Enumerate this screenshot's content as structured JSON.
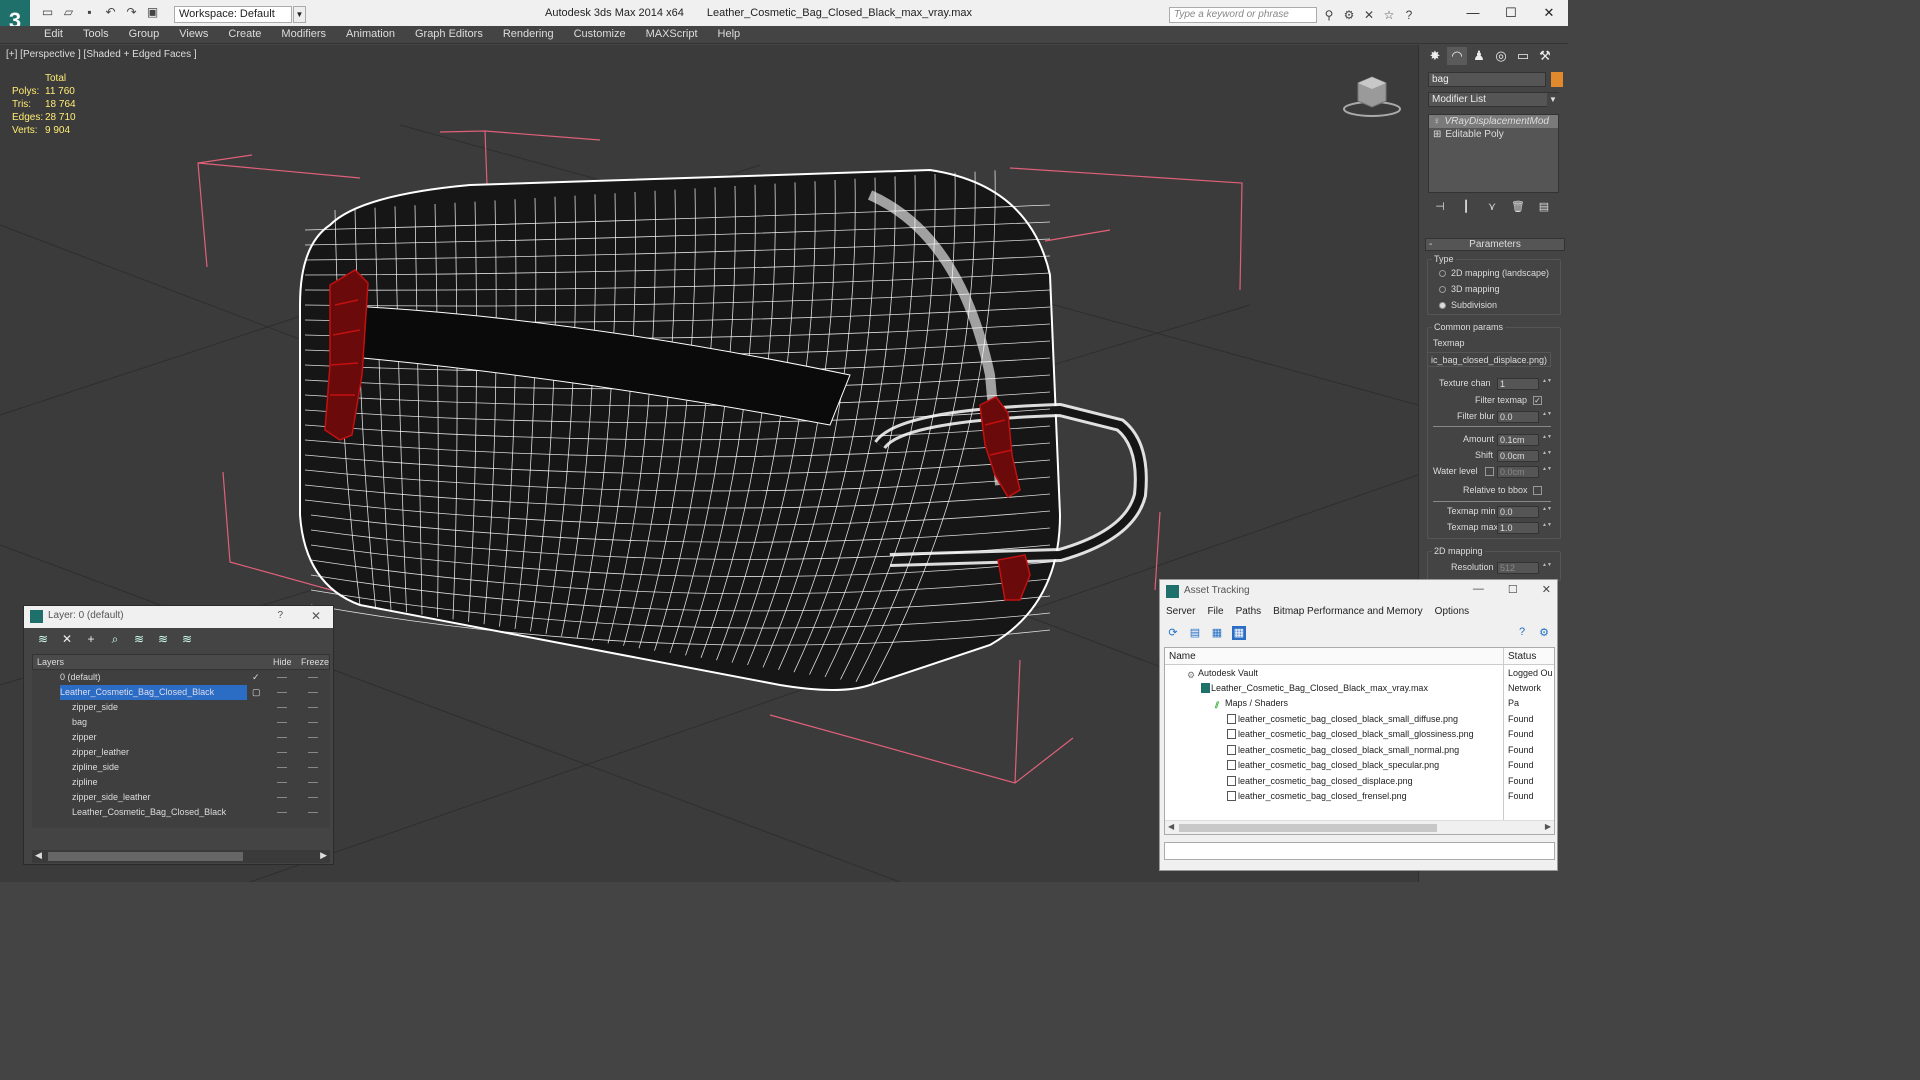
{
  "app": {
    "title": "Autodesk 3ds Max  2014 x64",
    "file": "Leather_Cosmetic_Bag_Closed_Black_max_vray.max",
    "logo": "3",
    "workspace": "Workspace: Default",
    "search_placeholder": "Type a keyword or phrase"
  },
  "menu": [
    "Edit",
    "Tools",
    "Group",
    "Views",
    "Create",
    "Modifiers",
    "Animation",
    "Graph Editors",
    "Rendering",
    "Customize",
    "MAXScript",
    "Help"
  ],
  "viewport": {
    "label": "[+] [Perspective ] [Shaded + Edged Faces ]",
    "stats": {
      "header": "Total",
      "rows": [
        {
          "k": "Polys:",
          "v": "11 760"
        },
        {
          "k": "Tris:",
          "v": "18 764"
        },
        {
          "k": "Edges:",
          "v": "28 710"
        },
        {
          "k": "Verts:",
          "v": "9 904"
        }
      ]
    }
  },
  "command_panel": {
    "object_name": "bag",
    "modifier_list": "Modifier List",
    "stack": [
      "VRayDisplacementMod",
      "Editable Poly"
    ],
    "rollout_title": "Parameters",
    "type_group": "Type",
    "type_options": [
      "2D mapping (landscape)",
      "3D mapping",
      "Subdivision"
    ],
    "type_selected": 2,
    "common_group": "Common params",
    "texmap_label": "Texmap",
    "texmap_value": "ic_bag_closed_displace.png)",
    "texture_chan_label": "Texture chan",
    "texture_chan_value": "1",
    "filter_texmap_label": "Filter texmap",
    "filter_blur_label": "Filter blur",
    "filter_blur_value": "0.0",
    "amount_label": "Amount",
    "amount_value": "0.1cm",
    "shift_label": "Shift",
    "shift_value": "0.0cm",
    "water_level_label": "Water level",
    "water_level_value": "0.0cm",
    "relative_bbox_label": "Relative to bbox",
    "texmap_min_label": "Texmap min",
    "texmap_min_value": "0.0",
    "texmap_max_label": "Texmap max",
    "texmap_max_value": "1.0",
    "mapping2d_group": "2D mapping",
    "resolution_label": "Resolution",
    "resolution_value": "512"
  },
  "layer_window": {
    "title": "Layer: 0 (default)",
    "help": "?",
    "col_layers": "Layers",
    "col_hide": "Hide",
    "col_freeze": "Freeze",
    "rows": [
      {
        "name": "0 (default)",
        "level": 0
      },
      {
        "name": "Leather_Cosmetic_Bag_Closed_Black",
        "level": 0
      },
      {
        "name": "zipper_side",
        "level": 1
      },
      {
        "name": "bag",
        "level": 1
      },
      {
        "name": "zipper",
        "level": 1
      },
      {
        "name": "zipper_leather",
        "level": 1
      },
      {
        "name": "zipline_side",
        "level": 1
      },
      {
        "name": "zipline",
        "level": 1
      },
      {
        "name": "zipper_side_leather",
        "level": 1
      },
      {
        "name": "Leather_Cosmetic_Bag_Closed_Black",
        "level": 1
      }
    ]
  },
  "asset_window": {
    "title": "Asset Tracking",
    "menu": [
      "Server",
      "File",
      "Paths",
      "Bitmap Performance and Memory",
      "Options"
    ],
    "col_name": "Name",
    "col_status": "Status",
    "rows": [
      {
        "name": "Autodesk Vault",
        "status": "Logged Ou",
        "indent": 1
      },
      {
        "name": "Leather_Cosmetic_Bag_Closed_Black_max_vray.max",
        "status": "Network Pa",
        "indent": 2
      },
      {
        "name": "Maps / Shaders",
        "status": "",
        "indent": 3
      },
      {
        "name": "leather_cosmetic_bag_closed_black_small_diffuse.png",
        "status": "Found",
        "indent": 4
      },
      {
        "name": "leather_cosmetic_bag_closed_black_small_glossiness.png",
        "status": "Found",
        "indent": 4
      },
      {
        "name": "leather_cosmetic_bag_closed_black_small_normal.png",
        "status": "Found",
        "indent": 4
      },
      {
        "name": "leather_cosmetic_bag_closed_black_specular.png",
        "status": "Found",
        "indent": 4
      },
      {
        "name": "leather_cosmetic_bag_closed_displace.png",
        "status": "Found",
        "indent": 4
      },
      {
        "name": "leather_cosmetic_bag_closed_frensel.png",
        "status": "Found",
        "indent": 4
      }
    ]
  },
  "colors": {
    "bbox": "#e0607a",
    "wire": "#ffffff",
    "zipper": "#c41010",
    "stats": "#ffec73",
    "selection": "#2b6cc4"
  }
}
